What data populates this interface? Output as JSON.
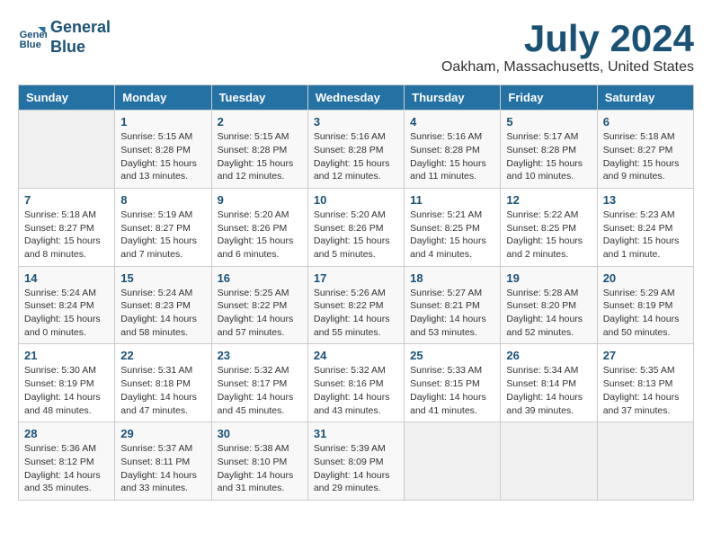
{
  "header": {
    "logo_line1": "General",
    "logo_line2": "Blue",
    "month": "July 2024",
    "location": "Oakham, Massachusetts, United States"
  },
  "days_of_week": [
    "Sunday",
    "Monday",
    "Tuesday",
    "Wednesday",
    "Thursday",
    "Friday",
    "Saturday"
  ],
  "weeks": [
    [
      {
        "day": "",
        "info": ""
      },
      {
        "day": "1",
        "info": "Sunrise: 5:15 AM\nSunset: 8:28 PM\nDaylight: 15 hours\nand 13 minutes."
      },
      {
        "day": "2",
        "info": "Sunrise: 5:15 AM\nSunset: 8:28 PM\nDaylight: 15 hours\nand 12 minutes."
      },
      {
        "day": "3",
        "info": "Sunrise: 5:16 AM\nSunset: 8:28 PM\nDaylight: 15 hours\nand 12 minutes."
      },
      {
        "day": "4",
        "info": "Sunrise: 5:16 AM\nSunset: 8:28 PM\nDaylight: 15 hours\nand 11 minutes."
      },
      {
        "day": "5",
        "info": "Sunrise: 5:17 AM\nSunset: 8:28 PM\nDaylight: 15 hours\nand 10 minutes."
      },
      {
        "day": "6",
        "info": "Sunrise: 5:18 AM\nSunset: 8:27 PM\nDaylight: 15 hours\nand 9 minutes."
      }
    ],
    [
      {
        "day": "7",
        "info": "Sunrise: 5:18 AM\nSunset: 8:27 PM\nDaylight: 15 hours\nand 8 minutes."
      },
      {
        "day": "8",
        "info": "Sunrise: 5:19 AM\nSunset: 8:27 PM\nDaylight: 15 hours\nand 7 minutes."
      },
      {
        "day": "9",
        "info": "Sunrise: 5:20 AM\nSunset: 8:26 PM\nDaylight: 15 hours\nand 6 minutes."
      },
      {
        "day": "10",
        "info": "Sunrise: 5:20 AM\nSunset: 8:26 PM\nDaylight: 15 hours\nand 5 minutes."
      },
      {
        "day": "11",
        "info": "Sunrise: 5:21 AM\nSunset: 8:25 PM\nDaylight: 15 hours\nand 4 minutes."
      },
      {
        "day": "12",
        "info": "Sunrise: 5:22 AM\nSunset: 8:25 PM\nDaylight: 15 hours\nand 2 minutes."
      },
      {
        "day": "13",
        "info": "Sunrise: 5:23 AM\nSunset: 8:24 PM\nDaylight: 15 hours\nand 1 minute."
      }
    ],
    [
      {
        "day": "14",
        "info": "Sunrise: 5:24 AM\nSunset: 8:24 PM\nDaylight: 15 hours\nand 0 minutes."
      },
      {
        "day": "15",
        "info": "Sunrise: 5:24 AM\nSunset: 8:23 PM\nDaylight: 14 hours\nand 58 minutes."
      },
      {
        "day": "16",
        "info": "Sunrise: 5:25 AM\nSunset: 8:22 PM\nDaylight: 14 hours\nand 57 minutes."
      },
      {
        "day": "17",
        "info": "Sunrise: 5:26 AM\nSunset: 8:22 PM\nDaylight: 14 hours\nand 55 minutes."
      },
      {
        "day": "18",
        "info": "Sunrise: 5:27 AM\nSunset: 8:21 PM\nDaylight: 14 hours\nand 53 minutes."
      },
      {
        "day": "19",
        "info": "Sunrise: 5:28 AM\nSunset: 8:20 PM\nDaylight: 14 hours\nand 52 minutes."
      },
      {
        "day": "20",
        "info": "Sunrise: 5:29 AM\nSunset: 8:19 PM\nDaylight: 14 hours\nand 50 minutes."
      }
    ],
    [
      {
        "day": "21",
        "info": "Sunrise: 5:30 AM\nSunset: 8:19 PM\nDaylight: 14 hours\nand 48 minutes."
      },
      {
        "day": "22",
        "info": "Sunrise: 5:31 AM\nSunset: 8:18 PM\nDaylight: 14 hours\nand 47 minutes."
      },
      {
        "day": "23",
        "info": "Sunrise: 5:32 AM\nSunset: 8:17 PM\nDaylight: 14 hours\nand 45 minutes."
      },
      {
        "day": "24",
        "info": "Sunrise: 5:32 AM\nSunset: 8:16 PM\nDaylight: 14 hours\nand 43 minutes."
      },
      {
        "day": "25",
        "info": "Sunrise: 5:33 AM\nSunset: 8:15 PM\nDaylight: 14 hours\nand 41 minutes."
      },
      {
        "day": "26",
        "info": "Sunrise: 5:34 AM\nSunset: 8:14 PM\nDaylight: 14 hours\nand 39 minutes."
      },
      {
        "day": "27",
        "info": "Sunrise: 5:35 AM\nSunset: 8:13 PM\nDaylight: 14 hours\nand 37 minutes."
      }
    ],
    [
      {
        "day": "28",
        "info": "Sunrise: 5:36 AM\nSunset: 8:12 PM\nDaylight: 14 hours\nand 35 minutes."
      },
      {
        "day": "29",
        "info": "Sunrise: 5:37 AM\nSunset: 8:11 PM\nDaylight: 14 hours\nand 33 minutes."
      },
      {
        "day": "30",
        "info": "Sunrise: 5:38 AM\nSunset: 8:10 PM\nDaylight: 14 hours\nand 31 minutes."
      },
      {
        "day": "31",
        "info": "Sunrise: 5:39 AM\nSunset: 8:09 PM\nDaylight: 14 hours\nand 29 minutes."
      },
      {
        "day": "",
        "info": ""
      },
      {
        "day": "",
        "info": ""
      },
      {
        "day": "",
        "info": ""
      }
    ]
  ]
}
